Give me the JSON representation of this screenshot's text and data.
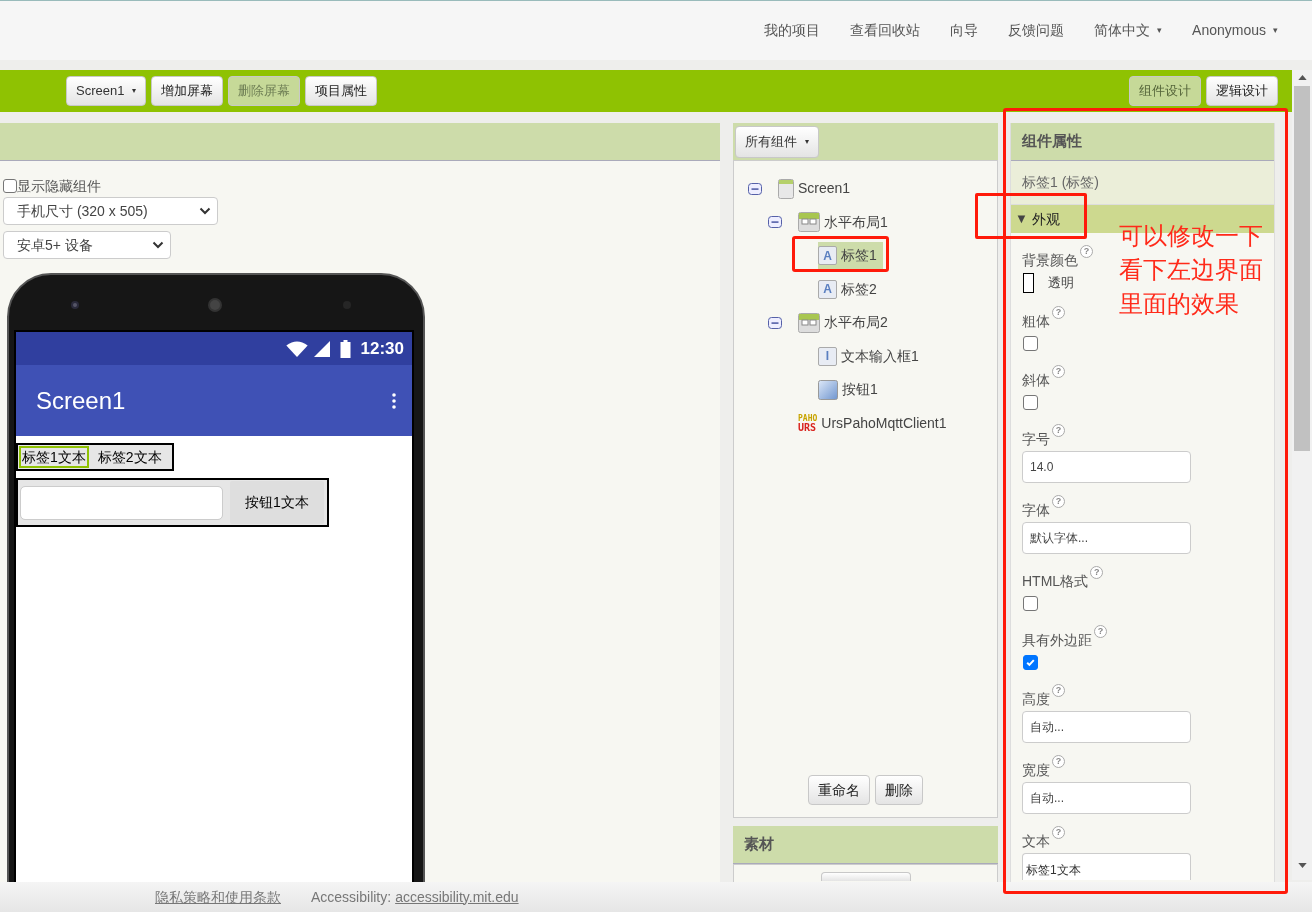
{
  "top_nav": {
    "links": [
      {
        "label": "我的项目"
      },
      {
        "label": "查看回收站"
      },
      {
        "label": "向导"
      },
      {
        "label": "反馈问题"
      },
      {
        "label": "简体中文",
        "caret": "▾"
      },
      {
        "label": "Anonymous",
        "caret": "▾"
      }
    ]
  },
  "toolbar": {
    "screen_menu": {
      "label": "Screen1",
      "caret": "▾"
    },
    "buttons": [
      {
        "label": "增加屏幕",
        "disabled": false
      },
      {
        "label": "删除屏幕",
        "disabled": true
      },
      {
        "label": "项目属性",
        "disabled": false
      }
    ],
    "view_tabs": [
      {
        "label": "组件设计",
        "selected": true
      },
      {
        "label": "逻辑设计",
        "selected": false
      }
    ]
  },
  "viewer": {
    "show_hidden": {
      "label": "显示隐藏组件",
      "checked": false
    },
    "size_select": "手机尺寸 (320 x 505)",
    "theme_select": "安卓5+ 设备",
    "phone": {
      "time": "12:30",
      "title": "Screen1",
      "arrangements": [
        {
          "items": [
            {
              "kind": "label",
              "text": "标签1文本",
              "selected": true
            },
            {
              "kind": "label",
              "text": "标签2文本",
              "selected": false
            }
          ]
        },
        {
          "items": [
            {
              "kind": "textbox",
              "selected": false
            },
            {
              "kind": "button",
              "text": "按钮1文本",
              "selected": false
            }
          ]
        }
      ]
    }
  },
  "components": {
    "filter": {
      "label": "所有组件",
      "caret": "▾"
    },
    "tree": [
      {
        "label": "Screen1",
        "kind": "screen",
        "expanded": true,
        "selected": false,
        "children": [
          {
            "label": "水平布局1",
            "kind": "arrangement",
            "expanded": true,
            "selected": false,
            "children": [
              {
                "label": "标签1",
                "kind": "label",
                "badge": "A",
                "selected": true
              },
              {
                "label": "标签2",
                "kind": "label",
                "badge": "A",
                "selected": false
              }
            ]
          },
          {
            "label": "水平布局2",
            "kind": "arrangement",
            "expanded": true,
            "selected": false,
            "children": [
              {
                "label": "文本输入框1",
                "kind": "textbox",
                "badge": "I",
                "selected": false
              },
              {
                "label": "按钮1",
                "kind": "button",
                "selected": false
              }
            ]
          },
          {
            "label": "UrsPahoMqttClient1",
            "kind": "extension",
            "badge_lines": [
              "PAHO",
              "URS"
            ],
            "selected": false
          }
        ]
      }
    ],
    "buttons": [
      "重命名",
      "删除"
    ]
  },
  "media": {
    "title": "素材"
  },
  "properties": {
    "title": "组件属性",
    "component": "标签1 (标签)",
    "section": {
      "toggle": "▼",
      "label": "外观"
    },
    "items": [
      {
        "kind": "color",
        "label": "背景颜色",
        "help": "?",
        "value": "透明"
      },
      {
        "kind": "checkbox",
        "label": "粗体",
        "help": "?",
        "checked": false
      },
      {
        "kind": "checkbox",
        "label": "斜体",
        "help": "?",
        "checked": false
      },
      {
        "kind": "field",
        "label": "字号",
        "help": "?",
        "value": "14.0"
      },
      {
        "kind": "field",
        "label": "字体",
        "help": "?",
        "value": "默认字体..."
      },
      {
        "kind": "checkbox",
        "label": "HTML格式",
        "help": "?",
        "checked": false
      },
      {
        "kind": "checkbox",
        "label": "具有外边距",
        "help": "?",
        "checked": true
      },
      {
        "kind": "field",
        "label": "高度",
        "help": "?",
        "value": "自动..."
      },
      {
        "kind": "field",
        "label": "宽度",
        "help": "?",
        "value": "自动..."
      },
      {
        "kind": "textarea",
        "label": "文本",
        "help": "?",
        "value": "标签1文本"
      }
    ]
  },
  "annotation": {
    "lines": [
      "可以修改一下",
      "看下左边界面",
      "里面的效果"
    ]
  },
  "footer": {
    "privacy_link": "隐私策略和使用条款",
    "accessibility_label": "Accessibility:",
    "accessibility_link": "accessibility.mit.edu"
  }
}
